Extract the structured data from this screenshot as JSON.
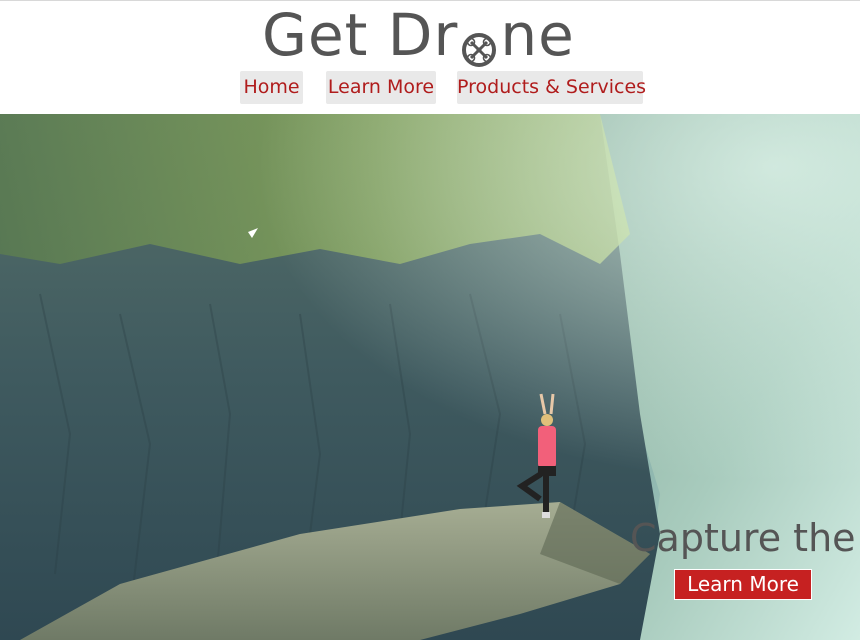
{
  "header": {
    "logo": {
      "text_before": "Get Dr",
      "icon": "drone-propeller-icon",
      "text_after": "ne"
    },
    "nav": [
      {
        "label": "Home"
      },
      {
        "label": "Learn More"
      },
      {
        "label": "Products & Services"
      }
    ]
  },
  "hero": {
    "image": "mountain-cliff-yoga-photo",
    "caption": "Capture the",
    "button_label": "Learn More"
  },
  "colors": {
    "nav_text": "#b01c1c",
    "nav_bg": "#e9e9e9",
    "logo_text": "#555555",
    "button_bg": "#c62121",
    "button_text": "#ffffff",
    "caption_text": "#555555"
  }
}
